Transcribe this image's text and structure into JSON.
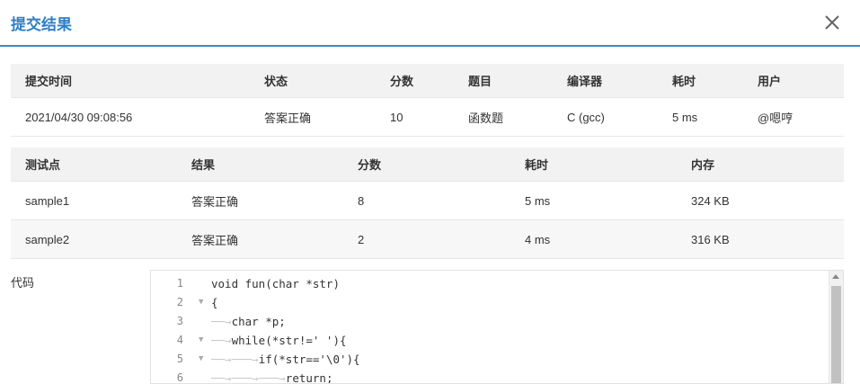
{
  "dialog": {
    "title": "提交结果"
  },
  "submission": {
    "headers": [
      "提交时间",
      "状态",
      "分数",
      "题目",
      "编译器",
      "耗时",
      "用户"
    ],
    "row": {
      "time": "2021/04/30 09:08:56",
      "status": "答案正确",
      "score": "10",
      "problem": "函数题",
      "compiler": "C (gcc)",
      "elapsed": "5 ms",
      "user": "@嗯哼"
    }
  },
  "testcases": {
    "headers": [
      "测试点",
      "结果",
      "分数",
      "耗时",
      "内存"
    ],
    "rows": [
      {
        "name": "sample1",
        "result": "答案正确",
        "score": "8",
        "elapsed": "5 ms",
        "memory": "324 KB"
      },
      {
        "name": "sample2",
        "result": "答案正确",
        "score": "2",
        "elapsed": "4 ms",
        "memory": "316 KB"
      }
    ]
  },
  "code": {
    "label": "代码",
    "lines": [
      {
        "n": "1",
        "fold": false,
        "text": "void fun(char *str)"
      },
      {
        "n": "2",
        "fold": true,
        "text": "{"
      },
      {
        "n": "3",
        "fold": false,
        "text": "char *p;"
      },
      {
        "n": "4",
        "fold": true,
        "text": "while(*str!=' '){"
      },
      {
        "n": "5",
        "fold": true,
        "text": "if(*str=='\\0'){"
      },
      {
        "n": "6",
        "fold": false,
        "text": "return;"
      }
    ]
  },
  "colors": {
    "accent": "#2e7fc5",
    "accepted": "#d9453c"
  }
}
